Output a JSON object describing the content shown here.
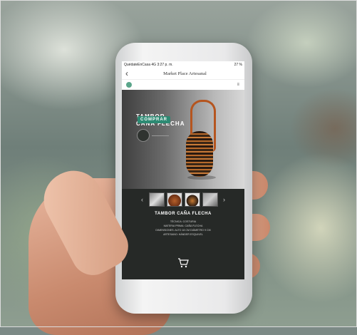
{
  "status_bar": {
    "carrier": "QuédateEnCasa",
    "network": "4G",
    "time": "3:27 p. m.",
    "battery": "27 %"
  },
  "nav": {
    "back_icon": "chevron-left-icon",
    "title": "Market Place Artesanal"
  },
  "app_bar": {
    "logo_icon": "leaf-logo-icon",
    "menu_icon": "menu-icon"
  },
  "hero": {
    "title": "TAMBOR\nCAÑA FLECHA",
    "buy_label": "COMPRAR"
  },
  "gallery": {
    "prev_icon": "chevron-left-icon",
    "next_icon": "chevron-right-icon",
    "thumbnail_count": 4
  },
  "product": {
    "name": "TAMBOR CAÑA FLECHA",
    "details": [
      "TÉCNICA: COSTURIA",
      "MATERIA PRIMA: CAÑA FLECHA",
      "DIMENSIONES: ALTO 18 CM DIÁMETRO 9 CM",
      "ARTESANO: HÁNDER ESQUIVEL"
    ]
  },
  "cart_icon": "shopping-cart-icon",
  "colors": {
    "accent": "#2d8a73",
    "panel": "#262927",
    "basket": "#b5551f"
  }
}
